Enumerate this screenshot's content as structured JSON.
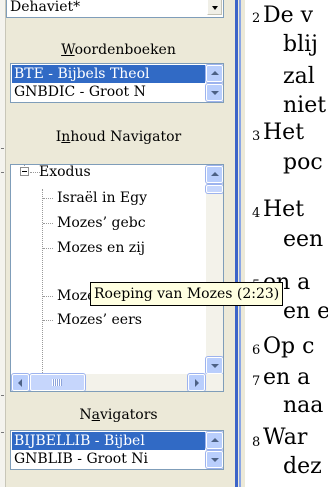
{
  "version_combo": {
    "value": "Dehaviet*"
  },
  "woordenboeken": {
    "label_u": "W",
    "label_rest": "oordenboeken",
    "items": [
      "BTE - Bijbels Theol",
      "GNBDIC - Groot N"
    ]
  },
  "inhoud": {
    "label_a": "I",
    "label_u": "n",
    "label_rest": "houd Navigator",
    "root": "Exodus",
    "children": [
      "Israël in Egy",
      "Mozes’ gebc",
      "Mozes en zij",
      "Roeping van Mozes (2:23)",
      "Mozes’ terug",
      "Mozes’ eers"
    ]
  },
  "tooltip": "Roeping van Mozes (2:23)",
  "navigators": {
    "label_a": "N",
    "label_u": "a",
    "label_rest": "vigators",
    "items": [
      "BIJBELLIB - Bijbel",
      "GNBLIB - Groot Ni"
    ]
  },
  "bible_text": {
    "verses": [
      {
        "num": "2",
        "lines": [
          "De v",
          "blij",
          "zal",
          "niet"
        ]
      },
      {
        "num": "3",
        "lines": [
          "Het",
          "poc"
        ]
      },
      {
        "num": "4",
        "lines": [
          "Het",
          "een"
        ]
      },
      {
        "num": "5",
        "lines": [
          "en a",
          "en e"
        ]
      },
      {
        "num": "6",
        "lines": [
          "Op c"
        ]
      },
      {
        "num": "7",
        "lines": [
          "en a",
          "naa"
        ]
      },
      {
        "num": "8",
        "lines": [
          "War",
          "dez"
        ]
      }
    ]
  }
}
